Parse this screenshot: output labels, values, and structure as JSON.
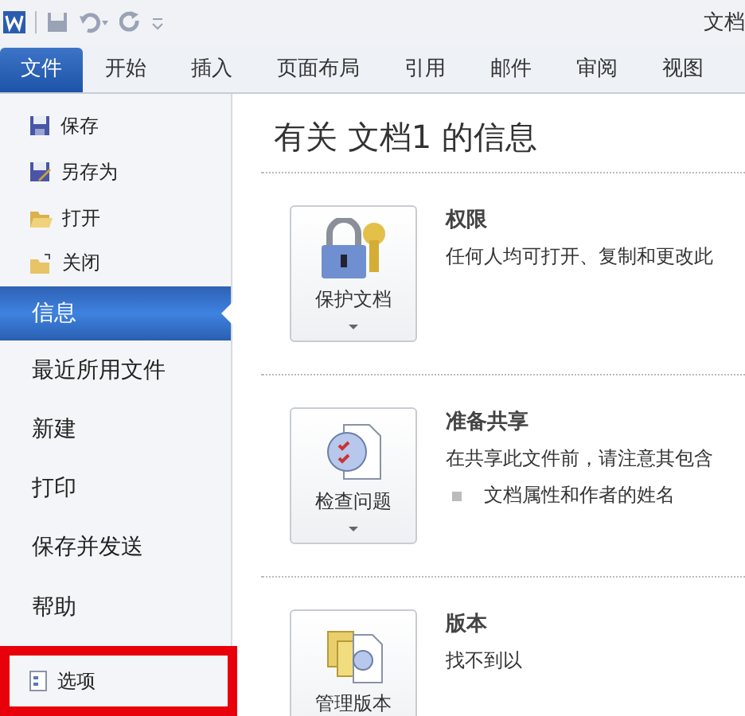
{
  "window": {
    "title": "文档"
  },
  "quick_access": [
    {
      "kind": "save"
    },
    {
      "kind": "undo"
    },
    {
      "kind": "redo"
    },
    {
      "kind": "customize"
    }
  ],
  "tabs": [
    {
      "label": "文件",
      "selected": true
    },
    {
      "label": "开始",
      "selected": false
    },
    {
      "label": "插入",
      "selected": false
    },
    {
      "label": "页面布局",
      "selected": false
    },
    {
      "label": "引用",
      "selected": false
    },
    {
      "label": "邮件",
      "selected": false
    },
    {
      "label": "审阅",
      "selected": false
    },
    {
      "label": "视图",
      "selected": false
    }
  ],
  "menu": [
    {
      "label": "保存",
      "kind": "small",
      "selected": false,
      "highlighted": false
    },
    {
      "label": "另存为",
      "kind": "small",
      "selected": false,
      "highlighted": false
    },
    {
      "label": "打开",
      "kind": "small",
      "selected": false,
      "highlighted": false
    },
    {
      "label": "关闭",
      "kind": "small",
      "selected": false,
      "highlighted": false
    },
    {
      "label": "信息",
      "kind": "large",
      "selected": true,
      "highlighted": false
    },
    {
      "label": "最近所用文件",
      "kind": "large",
      "selected": false,
      "highlighted": false
    },
    {
      "label": "新建",
      "kind": "large",
      "selected": false,
      "highlighted": false
    },
    {
      "label": "打印",
      "kind": "large",
      "selected": false,
      "highlighted": false
    },
    {
      "label": "保存并发送",
      "kind": "large",
      "selected": false,
      "highlighted": false
    },
    {
      "label": "帮助",
      "kind": "large",
      "selected": false,
      "highlighted": false
    },
    {
      "label": "选项",
      "kind": "small",
      "selected": false,
      "highlighted": true
    }
  ],
  "heading": "有关 文档1 的信息",
  "sections": [
    {
      "button": "保护文档",
      "title": "权限",
      "description": "任何人均可打开、复制和更改此"
    },
    {
      "button": "检查问题",
      "title": "准备共享",
      "description": "在共享此文件前，请注意其包含",
      "bullets": [
        "文档属性和作者的姓名"
      ]
    },
    {
      "button": "管理版本",
      "title": "版本",
      "description": "找不到以"
    }
  ]
}
